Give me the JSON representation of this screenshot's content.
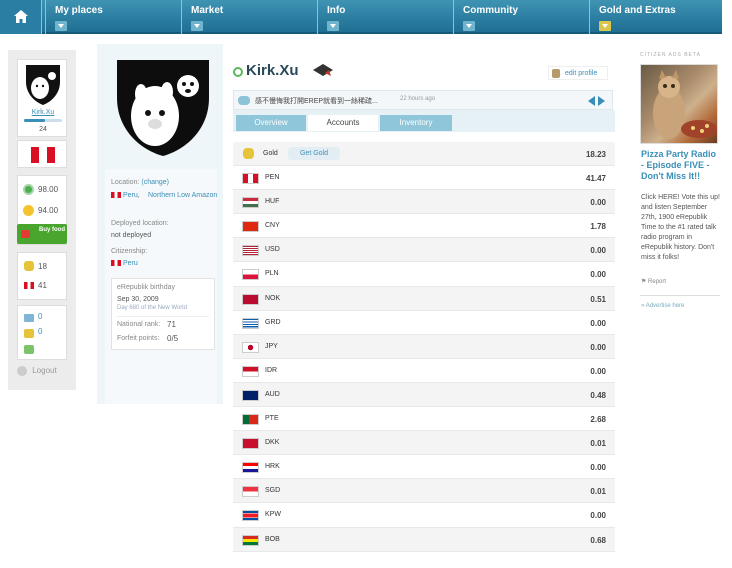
{
  "nav": {
    "items": [
      {
        "label": "My places"
      },
      {
        "label": "Market"
      },
      {
        "label": "Info"
      },
      {
        "label": "Community"
      },
      {
        "label": "Gold and Extras"
      }
    ]
  },
  "sidebar": {
    "username": "Kirk.Xu",
    "level": "24",
    "wellness": "98.00",
    "happiness": "94.00",
    "buy_food": "Buy food",
    "gold": "18",
    "currency": "41",
    "messages": "0",
    "alerts": "0",
    "logout": "Logout"
  },
  "profile": {
    "name": "Kirk.Xu",
    "edit_profile": "edit profile",
    "location_label": "Location:",
    "location_change": "(change)",
    "location_country": "Peru",
    "location_region": "Northern Low Amazon",
    "deployed_label": "Deployed location:",
    "deployed_value": "not deployed",
    "citizenship_label": "Citizenship:",
    "citizenship_value": "Peru",
    "birthday_label": "eRepublik birthday",
    "birthday_date": "Sep 30, 2009",
    "birthday_day": "Day 680 of the New World",
    "national_rank_label": "National rank:",
    "national_rank": "71",
    "forfeit_label": "Forfeit points:",
    "forfeit_value": "0/5"
  },
  "shout": {
    "text": "感不慢悔我打開EREP就看到一絲稀疏...",
    "time": "22 hours ago"
  },
  "tabs": [
    {
      "label": "Overview"
    },
    {
      "label": "Accounts"
    },
    {
      "label": "Inventory"
    }
  ],
  "accounts": [
    {
      "code": "Gold",
      "amount": "18.23"
    },
    {
      "code": "PEN",
      "amount": "41.47"
    },
    {
      "code": "HUF",
      "amount": "0.00"
    },
    {
      "code": "CNY",
      "amount": "1.78"
    },
    {
      "code": "USD",
      "amount": "0.00"
    },
    {
      "code": "PLN",
      "amount": "0.00"
    },
    {
      "code": "NOK",
      "amount": "0.51"
    },
    {
      "code": "GRD",
      "amount": "0.00"
    },
    {
      "code": "JPY",
      "amount": "0.00"
    },
    {
      "code": "IDR",
      "amount": "0.00"
    },
    {
      "code": "AUD",
      "amount": "0.48"
    },
    {
      "code": "PTE",
      "amount": "2.68"
    },
    {
      "code": "DKK",
      "amount": "0.01"
    },
    {
      "code": "HRK",
      "amount": "0.00"
    },
    {
      "code": "SGD",
      "amount": "0.01"
    },
    {
      "code": "KPW",
      "amount": "0.00"
    },
    {
      "code": "BOB",
      "amount": "0.68"
    }
  ],
  "get_gold": "Get Gold",
  "ad": {
    "header": "CITIZEN ADS BETA",
    "title": "Pizza Party Radio - Episode FIVE - Don't Miss It!!",
    "text": "Click HERE! Vote this up! and listen September 27th, 1900 eRepublik Time to the #1 rated talk radio program in eRepublik history. Don't miss it folks!",
    "report": "Report",
    "advertise": "Advertise here"
  },
  "colors": {
    "nav": "#2a7ea4",
    "accent": "#3a8fb7",
    "buy_food": "#4aa52f"
  }
}
